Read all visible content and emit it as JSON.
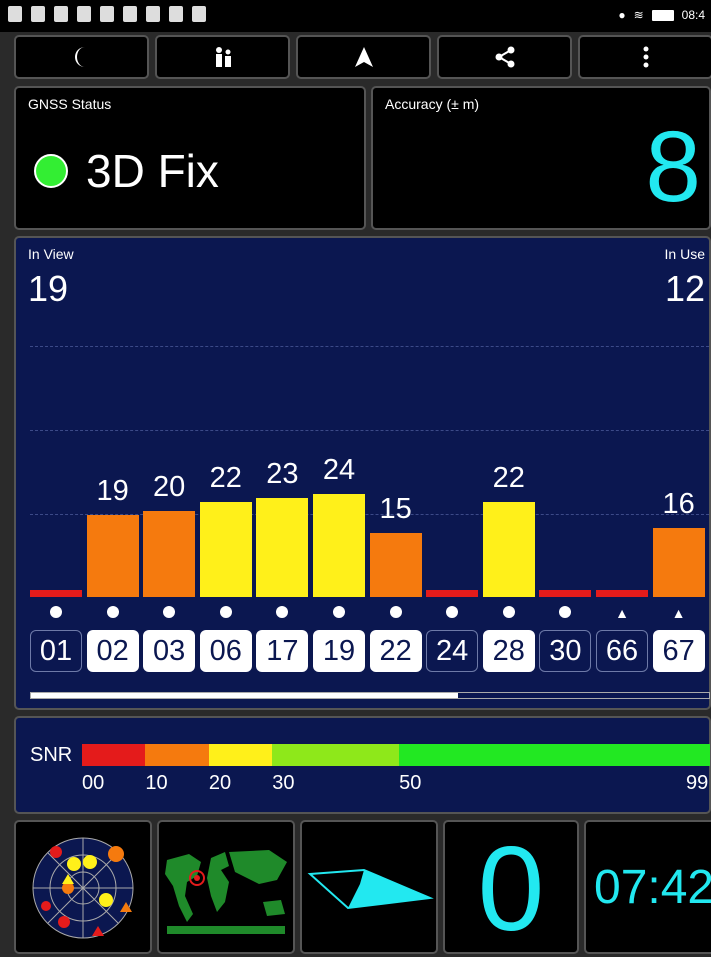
{
  "status_bar": {
    "time": "08:4"
  },
  "toolbar": {
    "buttons": [
      "night-mode",
      "scenario",
      "navigate",
      "share",
      "more"
    ]
  },
  "gnss": {
    "label": "GNSS Status",
    "fix": "3D Fix",
    "fix_color": "#33ee33"
  },
  "accuracy": {
    "label": "Accuracy (± m)",
    "value": "8"
  },
  "sky": {
    "in_view_label": "In View",
    "in_view": "19",
    "in_use_label": "In Use",
    "in_use": "12",
    "scroll_position": 0.63,
    "satellites": [
      {
        "prn": "01",
        "snr": null,
        "used": false,
        "marker": "dot",
        "color": "#e41b1b"
      },
      {
        "prn": "02",
        "snr": "19",
        "used": true,
        "marker": "dot",
        "color": "#f57a0e"
      },
      {
        "prn": "03",
        "snr": "20",
        "used": true,
        "marker": "dot",
        "color": "#f57a0e"
      },
      {
        "prn": "06",
        "snr": "22",
        "used": true,
        "marker": "dot",
        "color": "#fff01a"
      },
      {
        "prn": "17",
        "snr": "23",
        "used": true,
        "marker": "dot",
        "color": "#fff01a"
      },
      {
        "prn": "19",
        "snr": "24",
        "used": true,
        "marker": "dot",
        "color": "#fff01a"
      },
      {
        "prn": "22",
        "snr": "15",
        "used": true,
        "marker": "dot",
        "color": "#f57a0e"
      },
      {
        "prn": "24",
        "snr": null,
        "used": false,
        "marker": "dot",
        "color": "#e41b1b"
      },
      {
        "prn": "28",
        "snr": "22",
        "used": true,
        "marker": "dot",
        "color": "#fff01a"
      },
      {
        "prn": "30",
        "snr": null,
        "used": false,
        "marker": "dot",
        "color": "#e41b1b"
      },
      {
        "prn": "66",
        "snr": null,
        "used": false,
        "marker": "triangle",
        "color": "#e41b1b"
      },
      {
        "prn": "67",
        "snr": "16",
        "used": true,
        "marker": "triangle",
        "color": "#f57a0e"
      }
    ]
  },
  "snr_legend": {
    "label": "SNR",
    "ticks": [
      "00",
      "10",
      "20",
      "30",
      "50",
      "99"
    ],
    "segments": [
      {
        "from": 0,
        "to": 10,
        "color": "#e41b1b"
      },
      {
        "from": 10,
        "to": 20,
        "color": "#f57a0e"
      },
      {
        "from": 20,
        "to": 30,
        "color": "#fff01a"
      },
      {
        "from": 30,
        "to": 50,
        "color": "#8ee81a"
      },
      {
        "from": 50,
        "to": 99,
        "color": "#22e822"
      }
    ]
  },
  "bottom_tiles": {
    "speed": "0",
    "time": "07:42"
  }
}
